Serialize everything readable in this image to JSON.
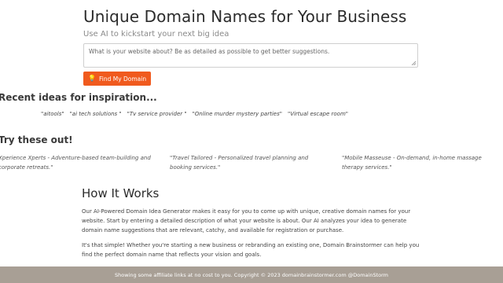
{
  "hero": {
    "title": "Unique Domain Names for Your Business",
    "subtitle": "Use AI to kickstart your next big idea",
    "textarea_placeholder": "What is your website about? Be as detailed as possible to get better suggestions.",
    "button_icon": "lightbulb-icon",
    "button_label": "Find My Domain"
  },
  "recent": {
    "heading": "Recent ideas for inspiration...",
    "items": [
      "\"aitools\"",
      "\"ai tech solutions \"",
      "\"Tv service provider \"",
      "\"Online murder mystery parties\"",
      "\"Virtual escape room\""
    ]
  },
  "try": {
    "heading": "Try these out!",
    "items": [
      "Xperience Xperts - Adventure-based team-building and corporate retreats.\"",
      "\"Travel Tailored - Personalized travel planning and booking services.\"",
      "\"Mobile Masseuse - On-demand, in-home massage therapy services.\""
    ]
  },
  "how": {
    "title": "How It Works",
    "p1": "Our AI-Powered Domain Idea Generator makes it easy for you to come up with unique, creative domain names for your website. Start by entering a detailed description of what your website is about. Our AI analyzes your idea to generate domain name suggestions that are relevant, catchy, and available for registration or purchase.",
    "p2": "It's that simple! Whether you're starting a new business or rebranding an existing one, Domain Brainstormer can help you find the perfect domain name that reflects your vision and goals."
  },
  "footer": {
    "text": "Showing some affiliate links at no cost to you. Copyright © 2023 domainbrainstormer.com @DomainStorm"
  },
  "colors": {
    "accent": "#f05a1e",
    "footer_bg": "#a89f95"
  }
}
